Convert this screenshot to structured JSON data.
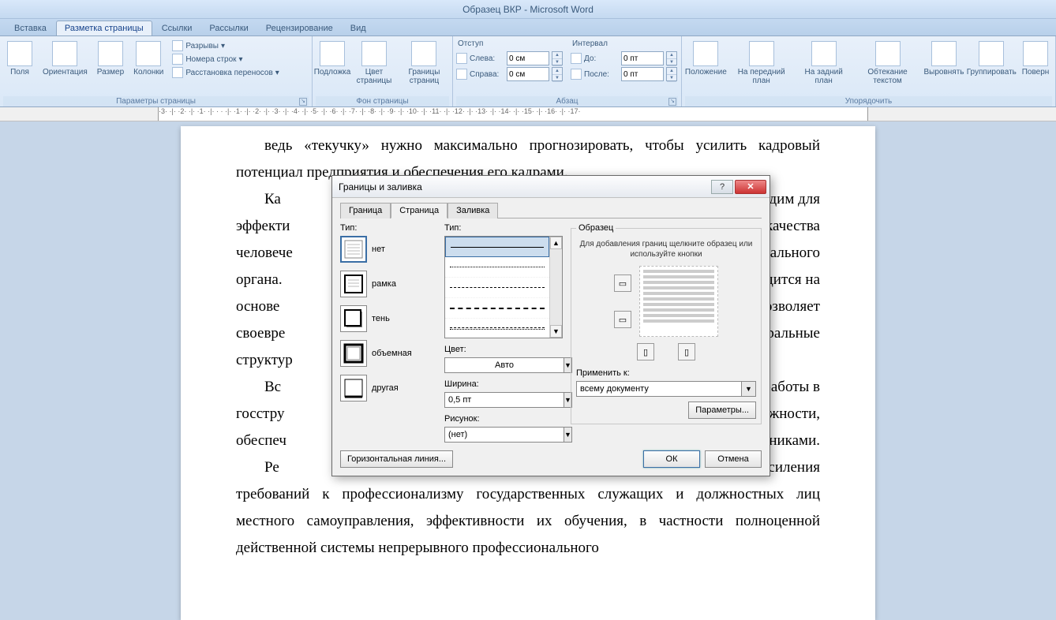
{
  "app": {
    "title": "Образец ВКР - Microsoft Word"
  },
  "tabs": {
    "t0": "Вставка",
    "t1": "Разметка страницы",
    "t2": "Ссылки",
    "t3": "Рассылки",
    "t4": "Рецензирование",
    "t5": "Вид"
  },
  "ribbon": {
    "page_setup": {
      "label": "Параметры страницы",
      "fields": "Поля",
      "orientation": "Ориентация",
      "size": "Размер",
      "columns": "Колонки",
      "breaks": "Разрывы",
      "line_numbers": "Номера строк",
      "hyphenation": "Расстановка переносов"
    },
    "page_bg": {
      "label": "Фон страницы",
      "watermark": "Подложка",
      "color": "Цвет страницы",
      "borders": "Границы страниц"
    },
    "paragraph": {
      "label": "Абзац",
      "indent_head": "Отступ",
      "spacing_head": "Интервал",
      "left": "Слева:",
      "right": "Справа:",
      "before": "До:",
      "after": "После:",
      "left_val": "0 см",
      "right_val": "0 см",
      "before_val": "0 пт",
      "after_val": "0 пт"
    },
    "arrange": {
      "label": "Упорядочить",
      "position": "Положение",
      "front": "На передний план",
      "back": "На задний план",
      "wrap": "Обтекание текстом",
      "align": "Выровнять",
      "group": "Группировать",
      "rotate": "Поверн"
    }
  },
  "document": {
    "p1": "ведь «текучку» нужно максимально прогнозировать, чтобы усилить кадровый потенциал предприятия и обеспечения его кадрами.",
    "p2a": "Ка",
    "p2b": "бходим для",
    "p3a": "эффекти",
    "p3b": "т качества",
    "p4a": "человече",
    "p4b": "едерального",
    "p5a": "органа.",
    "p5b": "водится на",
    "p6a": "основе",
    "p6b": "позволяет",
    "p7a": "своевре",
    "p7b": "едеральные",
    "p8a": "структур",
    "p8b": "",
    "p9a": "Вс",
    "p9b": "работы в",
    "p10a": "госстру",
    "p10b": "олжности,",
    "p11a": "обеспеч",
    "p11b": "никами.",
    "p12a": "Ре",
    "p12b": "усиления",
    "p13": "требований к профессионализму государственных служащих и должностных лиц местного самоуправления, эффективности их обучения, в частности полноценной действенной системы непрерывного профессионального"
  },
  "dialog": {
    "title": "Границы и заливка",
    "help": "?",
    "close": "✕",
    "tab_border": "Граница",
    "tab_page": "Страница",
    "tab_fill": "Заливка",
    "type_label": "Тип:",
    "setting_none": "нет",
    "setting_box": "рамка",
    "setting_shadow": "тень",
    "setting_3d": "объемная",
    "setting_custom": "другая",
    "style_label": "Тип:",
    "color_label": "Цвет:",
    "color_value": "Авто",
    "width_label": "Ширина:",
    "width_value": "0,5 пт",
    "art_label": "Рисунок:",
    "art_value": "(нет)",
    "preview_label": "Образец",
    "preview_hint": "Для добавления границ щелкните образец или используйте кнопки",
    "apply_label": "Применить к:",
    "apply_value": "всему документу",
    "options": "Параметры...",
    "hline": "Горизонтальная линия...",
    "ok": "ОК",
    "cancel": "Отмена"
  }
}
